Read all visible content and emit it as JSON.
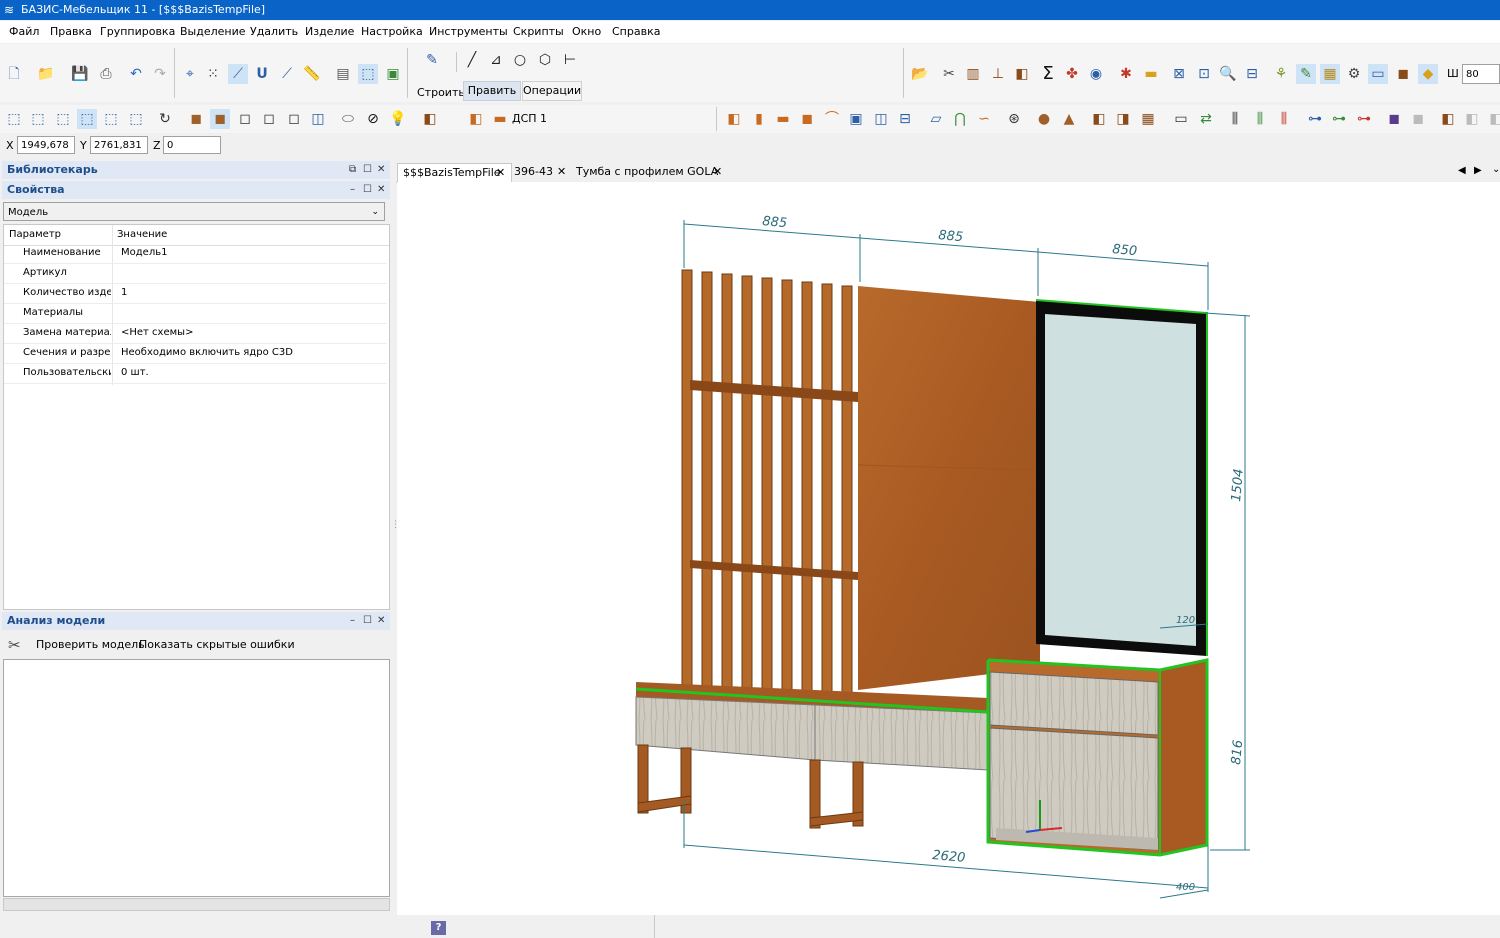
{
  "window": {
    "title": "БАЗИС-Мебельщик 11 - [$$$BazisTempFile]"
  },
  "menu": [
    "Файл",
    "Правка",
    "Группировка",
    "Выделение",
    "Удалить",
    "Изделие",
    "Настройка",
    "Инструменты",
    "Скрипты",
    "Окно",
    "Справка"
  ],
  "ribbon": {
    "build_label": "Строить",
    "tabs": [
      "Править",
      "Операции"
    ]
  },
  "toolbar": {
    "material_label": "ДСП 1",
    "width_label": "Ш",
    "width_value": "80"
  },
  "coords": {
    "x_label": "X",
    "x_value": "1949,678",
    "y_label": "Y",
    "y_value": "2761,831",
    "z_label": "Z",
    "z_value": "0"
  },
  "librarian": {
    "title": "Библиотекарь"
  },
  "properties": {
    "title": "Свойства",
    "dropdown_value": "Модель",
    "col_param": "Параметр",
    "col_value": "Значение",
    "rows": [
      {
        "key": "Наименование",
        "value": "Модель1"
      },
      {
        "key": "Артикул",
        "value": ""
      },
      {
        "key": "Количество издел",
        "value": "1"
      },
      {
        "key": "Материалы",
        "value": ""
      },
      {
        "key": "Замена материало",
        "value": "<Нет схемы>"
      },
      {
        "key": "Сечения и разрезы",
        "value": "Необходимо включить ядро C3D"
      },
      {
        "key": "Пользовательские",
        "value": "0 шт."
      }
    ]
  },
  "analysis": {
    "title": "Анализ модели",
    "check_label": "Проверить модель",
    "hidden_errors_label": "Показать скрытые ошибки"
  },
  "doc_tabs": [
    {
      "label": "$$$BazisTempFile"
    },
    {
      "label": "396-43"
    },
    {
      "label": "Тумба с профилем GOLA"
    }
  ],
  "dimensions": {
    "top1": "885",
    "top2": "885",
    "top3": "850",
    "right_upper": "1504",
    "right_lower": "816",
    "bottom": "2620",
    "small_top": "120",
    "small_bottom": "400"
  }
}
